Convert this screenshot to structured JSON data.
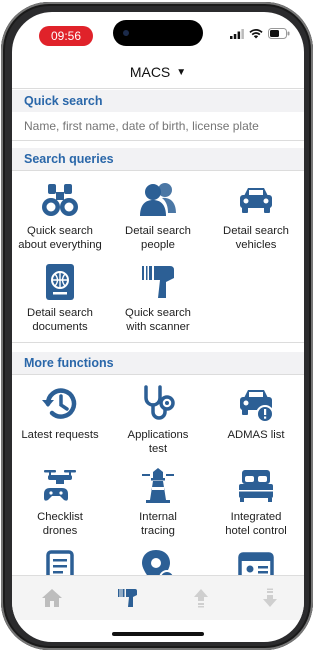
{
  "status": {
    "time": "09:56"
  },
  "header": {
    "title": "MACS",
    "caret": "▼"
  },
  "quick_search": {
    "label": "Quick search",
    "placeholder": "Name, first name, date of birth, license plate"
  },
  "search_queries": {
    "label": "Search queries",
    "items": [
      {
        "label": "Quick search\nabout everything",
        "icon": "binoculars-icon"
      },
      {
        "label": "Detail search\npeople",
        "icon": "people-icon"
      },
      {
        "label": "Detail search\nvehicles",
        "icon": "car-icon"
      },
      {
        "label": "Detail search\ndocuments",
        "icon": "passport-icon"
      },
      {
        "label": "Quick search\nwith scanner",
        "icon": "scanner-icon"
      }
    ]
  },
  "more_functions": {
    "label": "More functions",
    "items": [
      {
        "label": "Latest requests",
        "icon": "history-icon"
      },
      {
        "label": "Applications\ntest",
        "icon": "stethoscope-icon"
      },
      {
        "label": "ADMAS list",
        "icon": "car-alert-icon"
      },
      {
        "label": "Checklist\ndrones",
        "icon": "drone-icon"
      },
      {
        "label": "Internal\ntracing",
        "icon": "lighthouse-icon"
      },
      {
        "label": "Integrated\nhotel control",
        "icon": "bed-icon"
      },
      {
        "label": "",
        "icon": "document-icon"
      },
      {
        "label": "",
        "icon": "location-icon"
      },
      {
        "label": "",
        "icon": "id-card-icon"
      }
    ]
  },
  "tabbar": {
    "items": [
      "home-icon",
      "scanner-icon",
      "arrow-up-icon",
      "arrow-down-icon"
    ]
  },
  "colors": {
    "accent": "#2a67a9",
    "icon": "#2c5f95",
    "time_pill": "#e0222a"
  }
}
